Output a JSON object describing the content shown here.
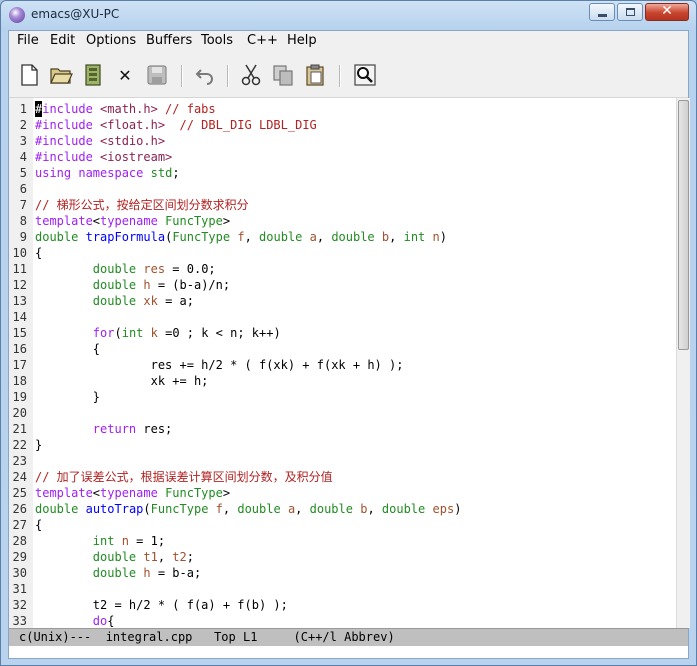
{
  "window": {
    "title": "emacs@XU-PC",
    "close_glyph": "✕"
  },
  "menu": [
    "File",
    "Edit",
    "Options",
    "Buffers",
    "Tools",
    "C++",
    "Help"
  ],
  "toolbar_icons": [
    "new-file-icon",
    "open-folder-icon",
    "dired-icon",
    "kill-buffer-icon",
    "save-icon",
    "undo-icon",
    "cut-icon",
    "copy-icon",
    "paste-icon",
    "search-icon"
  ],
  "toolbar": {
    "kill_glyph": "✕"
  },
  "cursor_char": "#",
  "lines": [
    "1",
    "2",
    "3",
    "4",
    "5",
    "6",
    "7",
    "8",
    "9",
    "10",
    "11",
    "12",
    "13",
    "14",
    "15",
    "16",
    "17",
    "18",
    "19",
    "20",
    "21",
    "22",
    "23",
    "24",
    "25",
    "26",
    "27",
    "28",
    "29",
    "30",
    "31",
    "32",
    "33"
  ],
  "code": {
    "l1": [
      "#include",
      " <math.h>",
      " // fabs"
    ],
    "l2": [
      "#include",
      " <float.h>",
      "  // DBL_DIG LDBL_DIG"
    ],
    "l3": [
      "#include",
      " <stdio.h>"
    ],
    "l4": [
      "#include",
      " <iostream>"
    ],
    "l5": [
      "using",
      " ",
      "namespace",
      " ",
      "std",
      ";"
    ],
    "l7": "// 梯形公式，按给定区间划分数求积分",
    "l8": [
      "template",
      "<",
      "typename",
      " ",
      "FuncType",
      ">"
    ],
    "l9": [
      "double",
      " ",
      "trapFormula",
      "(",
      "FuncType",
      " ",
      "f",
      ", ",
      "double",
      " ",
      "a",
      ", ",
      "double",
      " ",
      "b",
      ", ",
      "int",
      " ",
      "n",
      ")"
    ],
    "l10": "{",
    "l11": [
      "        ",
      "double",
      " ",
      "res",
      " = 0.0;"
    ],
    "l12": [
      "        ",
      "double",
      " ",
      "h",
      " = (b-a)/n;"
    ],
    "l13": [
      "        ",
      "double",
      " ",
      "xk",
      " = a;"
    ],
    "l15": [
      "        ",
      "for",
      "(",
      "int",
      " ",
      "k",
      " =0 ; k < n; k++)"
    ],
    "l16": "        {",
    "l17": "                res += h/2 * ( f(xk) + f(xk + h) );",
    "l18": "                xk += h;",
    "l19": "        }",
    "l21": [
      "        ",
      "return",
      " res;"
    ],
    "l22": "}",
    "l24": "// 加了误差公式，根据误差计算区间划分数，及积分值",
    "l25": [
      "template",
      "<",
      "typename",
      " ",
      "FuncType",
      ">"
    ],
    "l26": [
      "double",
      " ",
      "autoTrap",
      "(",
      "FuncType",
      " ",
      "f",
      ", ",
      "double",
      " ",
      "a",
      ", ",
      "double",
      " ",
      "b",
      ", ",
      "double",
      " ",
      "eps",
      ")"
    ],
    "l27": "{",
    "l28": [
      "        ",
      "int",
      " ",
      "n",
      " = 1;"
    ],
    "l29": [
      "        ",
      "double",
      " ",
      "t1",
      ", ",
      "t2",
      ";"
    ],
    "l30": [
      "        ",
      "double",
      " ",
      "h",
      " = b-a;"
    ],
    "l32": "        t2 = h/2 * ( f(a) + f(b) );",
    "l33": [
      "        ",
      "do",
      "{"
    ]
  },
  "modeline": "c(Unix)---  integral.cpp   Top L1     (C++/l Abbrev)",
  "colors": {
    "keyword": "#a020f0",
    "type": "#228b22",
    "function": "#0000ff",
    "comment": "#b22222",
    "string": "#8b2252",
    "variable": "#a0522d"
  }
}
